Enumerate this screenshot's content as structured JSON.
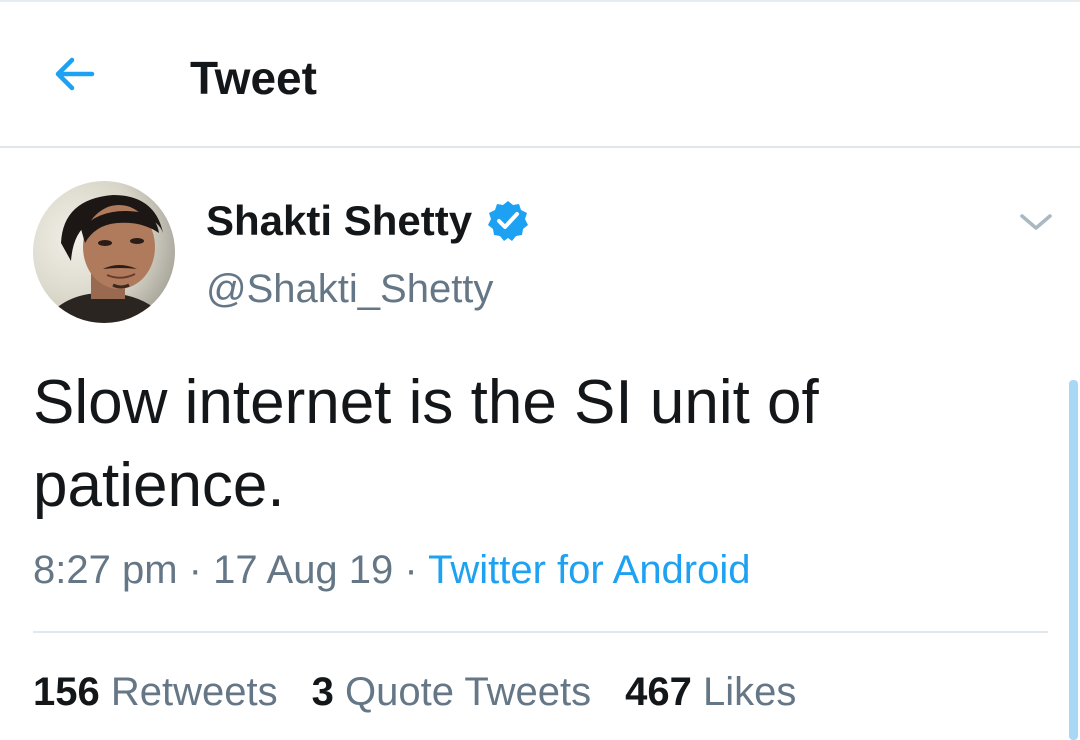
{
  "header": {
    "title": "Tweet",
    "back_icon": "arrow-left-icon"
  },
  "author": {
    "name": "Shakti Shetty",
    "handle": "@Shakti_Shetty",
    "verified": true,
    "verified_icon": "verified-badge-icon"
  },
  "tweet": {
    "text": "Slow internet is the SI unit of patience.",
    "time": "8:27 pm",
    "separator": "·",
    "date": "17 Aug 19",
    "source": "Twitter for Android"
  },
  "stats": [
    {
      "count": "156",
      "label": "Retweets"
    },
    {
      "count": "3",
      "label": "Quote Tweets"
    },
    {
      "count": "467",
      "label": "Likes"
    }
  ],
  "colors": {
    "accent": "#1da1f2",
    "text_primary": "#14171a",
    "text_secondary": "#657786",
    "divider": "#e1e8ed"
  }
}
